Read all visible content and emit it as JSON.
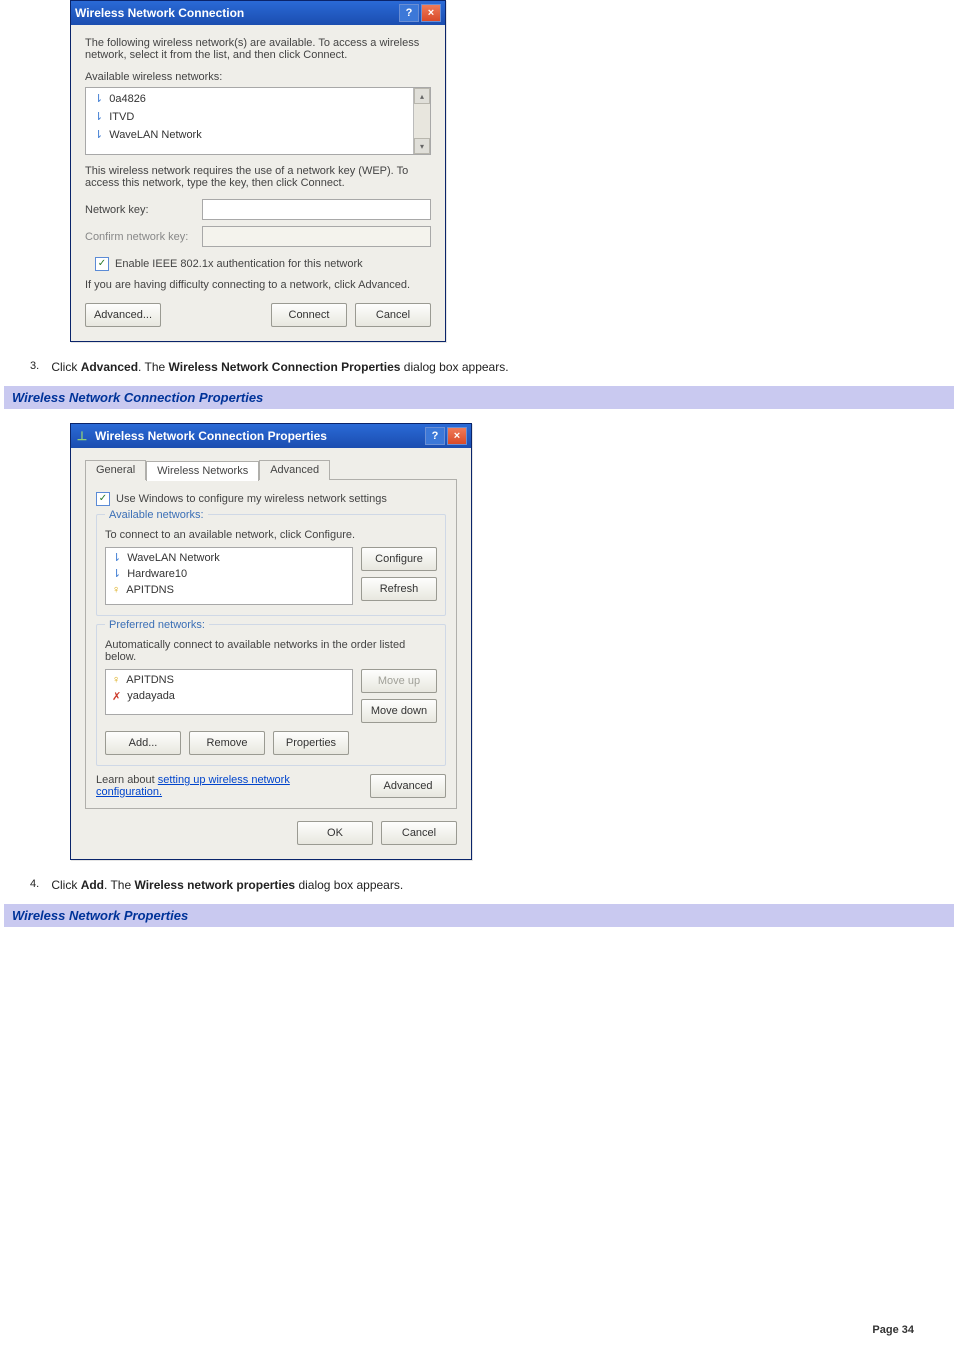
{
  "dialog1": {
    "title": "Wireless Network Connection",
    "intro": "The following wireless network(s) are available. To access a wireless network, select it from the list, and then click Connect.",
    "avail_label": "Available wireless networks:",
    "networks": [
      "0a4826",
      "ITVD",
      "WaveLAN Network"
    ],
    "wep_text": "This wireless network requires the use of a network key (WEP). To access this network, type the key, then click Connect.",
    "net_key_lbl": "Network key:",
    "confirm_lbl": "Confirm network key:",
    "ieee_label": "Enable IEEE 802.1x authentication for this network",
    "difficulty": "If you are having difficulty connecting to a network, click Advanced.",
    "advanced_btn": "Advanced...",
    "connect_btn": "Connect",
    "cancel_btn": "Cancel",
    "help": "?",
    "close": "×",
    "up": "▴",
    "down": "▾"
  },
  "step3": {
    "num": "3.",
    "pre": "Click ",
    "bold1": "Advanced",
    "mid": ". The ",
    "bold2": "Wireless Network Connection Properties",
    "post": " dialog box appears."
  },
  "sec1": "Wireless Network Connection Properties",
  "dialog2": {
    "title": "Wireless Network Connection Properties",
    "tabs": {
      "general": "General",
      "wireless": "Wireless Networks",
      "advanced": "Advanced"
    },
    "use_windows": "Use Windows to configure my wireless network settings",
    "avail_title": "Available networks:",
    "avail_hint": "To connect to an available network, click Configure.",
    "avail_items": [
      "WaveLAN Network",
      "Hardware10",
      "APITDNS"
    ],
    "configure_btn": "Configure",
    "refresh_btn": "Refresh",
    "pref_title": "Preferred networks:",
    "pref_hint": "Automatically connect to available networks in the order listed below.",
    "pref_items": [
      "APITDNS",
      "yadayada"
    ],
    "move_up": "Move up",
    "move_down": "Move down",
    "add_btn": "Add...",
    "remove_btn": "Remove",
    "props_btn": "Properties",
    "learn_pre": "Learn about ",
    "learn_link": "setting up wireless network configuration.",
    "adv_btn": "Advanced",
    "ok_btn": "OK",
    "cancel_btn": "Cancel",
    "help": "?",
    "close": "×",
    "check": "✓"
  },
  "step4": {
    "num": "4.",
    "pre": "Click ",
    "bold1": "Add",
    "mid": ". The ",
    "bold2": "Wireless network properties",
    "post": " dialog box appears."
  },
  "sec2": "Wireless Network Properties",
  "footer": "Page 34"
}
